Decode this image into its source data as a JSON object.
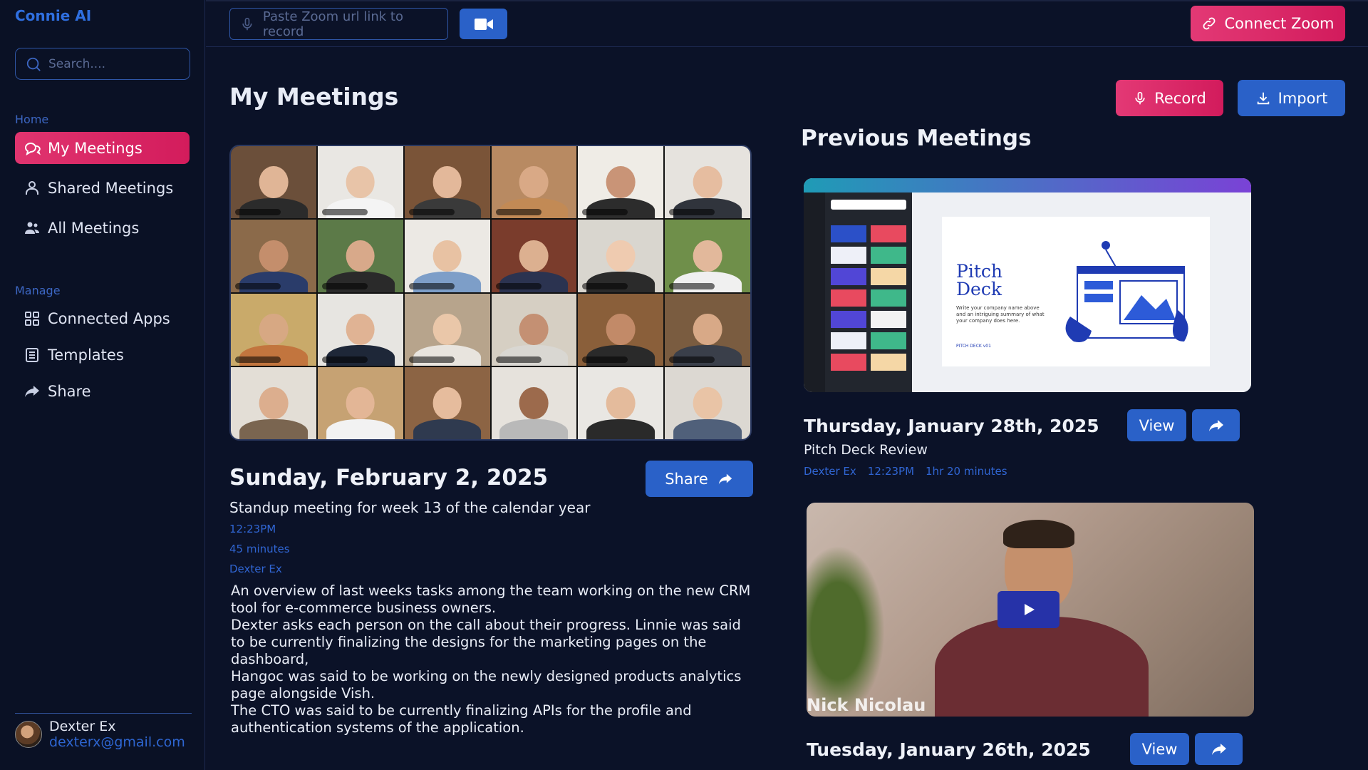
{
  "app": {
    "title": "Connie AI"
  },
  "sidebar": {
    "search_placeholder": "Search....",
    "home_label": "Home",
    "manage_label": "Manage",
    "home_items": [
      {
        "label": "My Meetings",
        "icon": "chat-bubbles-icon",
        "active": true
      },
      {
        "label": "Shared Meetings",
        "icon": "person-icon"
      },
      {
        "label": "All Meetings",
        "icon": "people-icon"
      }
    ],
    "manage_items": [
      {
        "label": "Connected Apps",
        "icon": "grid-icon"
      },
      {
        "label": "Templates",
        "icon": "template-icon"
      },
      {
        "label": "Share",
        "icon": "share-arrow-icon"
      }
    ],
    "user": {
      "name": "Dexter Ex",
      "email": "dexterx@gmail.com"
    }
  },
  "topbar": {
    "zoom_placeholder": "Paste Zoom url link to record",
    "connect_label": "Connect Zoom"
  },
  "main": {
    "title": "My Meetings",
    "record_label": "Record",
    "import_label": "Import",
    "current": {
      "date": "Sunday, February 2, 2025",
      "share_label": "Share",
      "subtitle": "Standup meeting for week 13 of the calendar year",
      "time": "12:23PM",
      "duration": "45 minutes",
      "host": "Dexter Ex",
      "description": "An overview of last weeks tasks among the team working on the new CRM tool for e-commerce business owners.\nDexter asks each person on the call about their progress. Linnie was said to be currently finalizing the designs for the marketing pages on the dashboard,\nHangoc was said to be working on the newly designed products analytics page alongside Vish.\nThe CTO was said to be currently finalizing APIs for the profile and authentication systems of the application."
    }
  },
  "previous": {
    "title": "Previous Meetings",
    "meetings": [
      {
        "date": "Thursday, January 28th, 2025",
        "subtitle": "Pitch Deck Review",
        "host": "Dexter Ex",
        "time": "12:23PM",
        "duration": "1hr 20 minutes",
        "view_label": "View",
        "slide_title_1": "Pitch",
        "slide_title_2": "Deck",
        "slide_text": "Write your company name above and an intriguing summary of what your company does here.",
        "slide_footer": "PITCH DECK v01"
      },
      {
        "date": "Tuesday, January 26th, 2025",
        "view_label": "View",
        "speaker": "Nick Nicolau"
      }
    ]
  },
  "colors": {
    "accent_pink": "#e0346f",
    "accent_blue": "#2a61c8",
    "background": "#0b1228"
  }
}
